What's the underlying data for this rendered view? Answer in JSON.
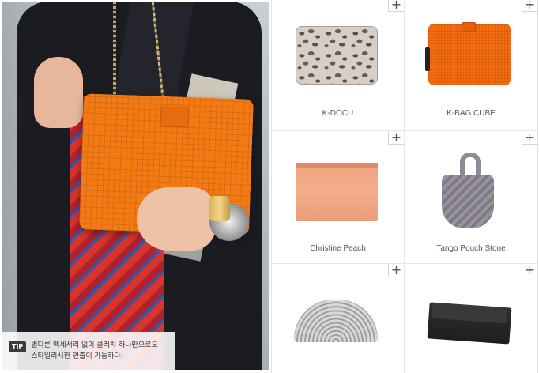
{
  "hero": {
    "tip": {
      "badge": "TIP",
      "text": "별다른 액세서리 없이 클러치 하나만으로도\n스타일리시한 연출이 가능하다."
    }
  },
  "products": [
    {
      "name": "K-DOCU",
      "add_label": "+"
    },
    {
      "name": "K-BAG CUBE",
      "add_label": "+"
    },
    {
      "name": "Christine Peach",
      "add_label": "+"
    },
    {
      "name": "Tango Pouch Stone",
      "add_label": "+"
    },
    {
      "name": "",
      "add_label": "+"
    },
    {
      "name": "",
      "add_label": "+"
    }
  ],
  "colors": {
    "accent_orange": "#f47a14",
    "border": "#e6e6e6",
    "label_text": "#555555"
  },
  "icons": [
    "plus-icon"
  ]
}
